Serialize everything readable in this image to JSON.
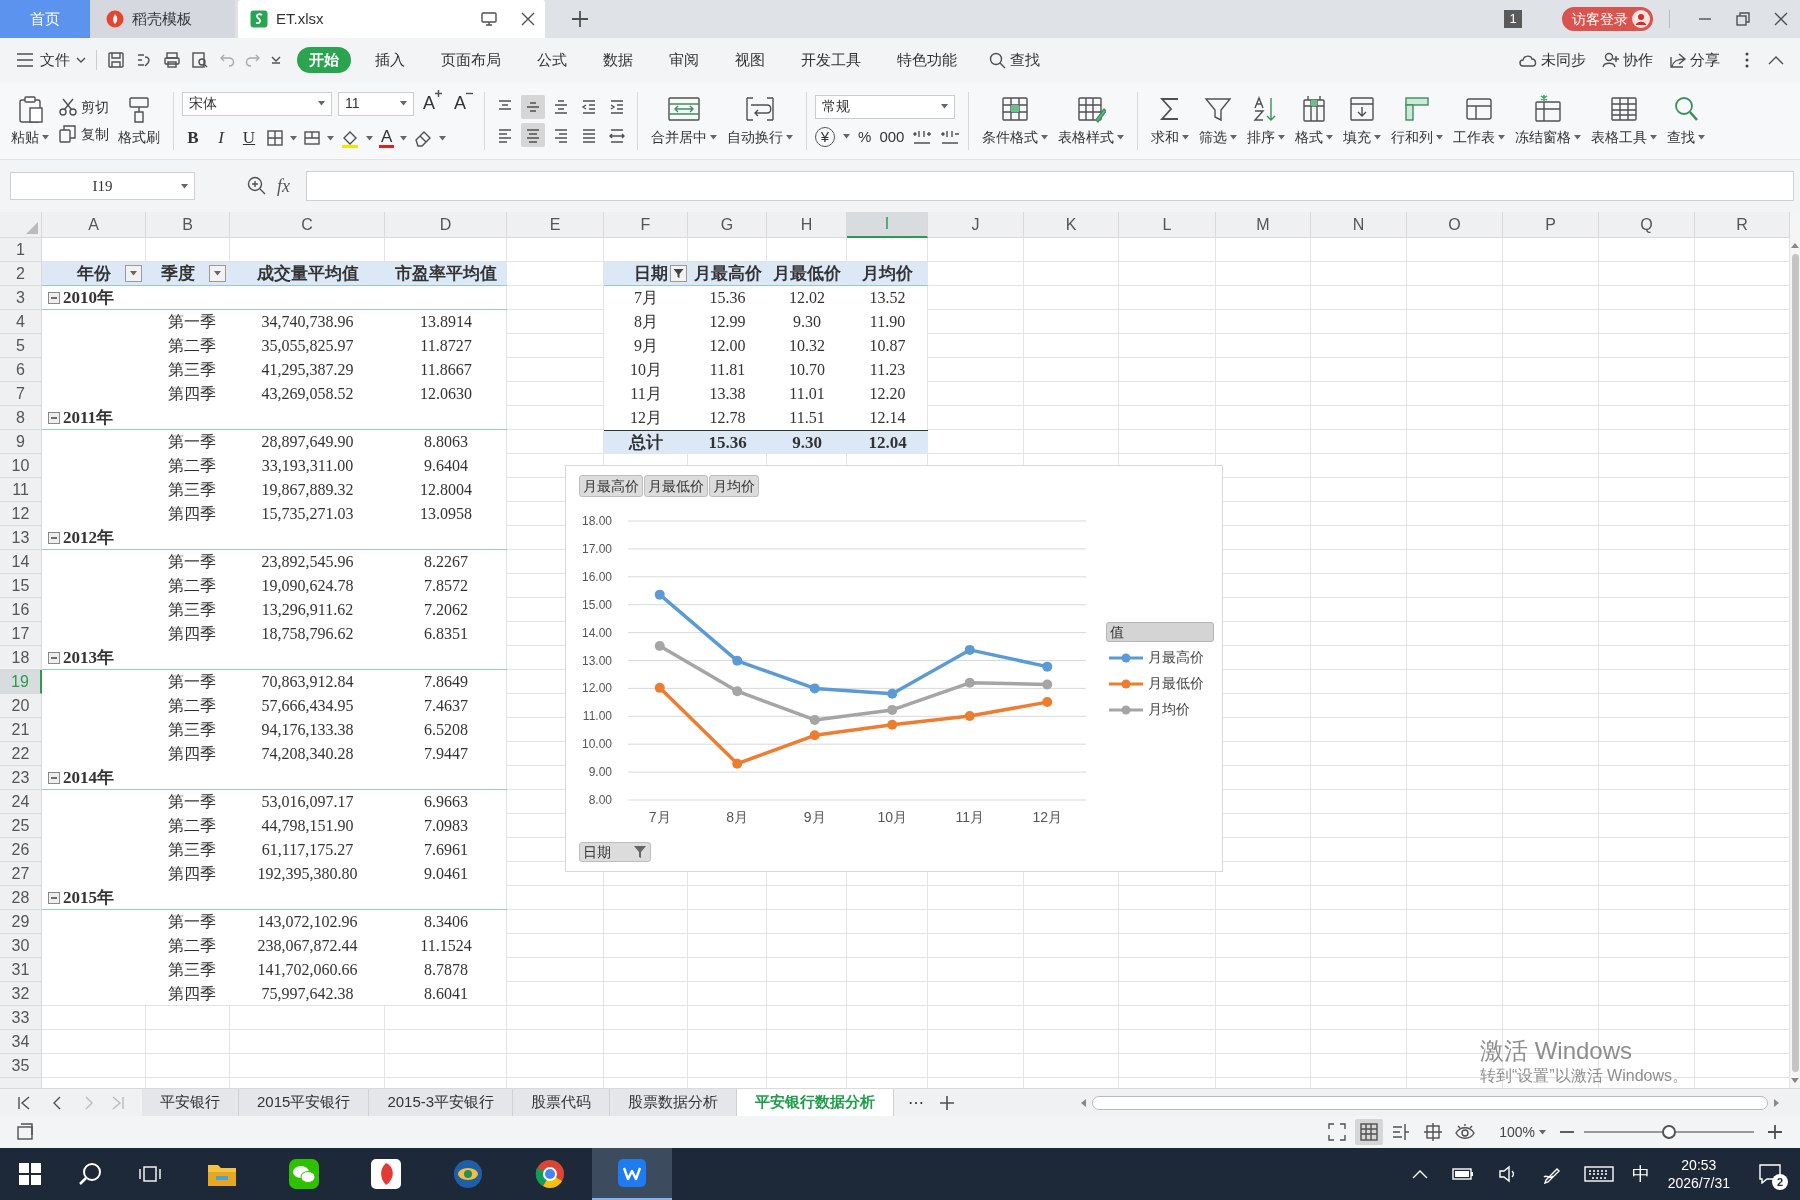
{
  "title_bar": {
    "tabs": [
      {
        "label": "首页",
        "kind": "home",
        "selected": false
      },
      {
        "label": "稻壳模板",
        "kind": "docer",
        "selected": false
      },
      {
        "label": "ET.xlsx",
        "kind": "sheet",
        "selected": true
      }
    ],
    "window_count": "1",
    "login": "访客登录"
  },
  "menu_bar": {
    "file": "文件",
    "tabs": [
      {
        "label": "开始",
        "selected": true
      },
      {
        "label": "插入",
        "selected": false
      },
      {
        "label": "页面布局",
        "selected": false
      },
      {
        "label": "公式",
        "selected": false
      },
      {
        "label": "数据",
        "selected": false
      },
      {
        "label": "审阅",
        "selected": false
      },
      {
        "label": "视图",
        "selected": false
      },
      {
        "label": "开发工具",
        "selected": false
      },
      {
        "label": "特色功能",
        "selected": false
      }
    ],
    "search": "查找",
    "actions": [
      "未同步",
      "协作",
      "分享"
    ]
  },
  "ribbon": {
    "clipboard": [
      {
        "label": "粘贴",
        "kind": "paste"
      },
      {
        "label": "剪切",
        "kind": "cut"
      },
      {
        "label": "复制",
        "kind": "copy"
      },
      {
        "label": "格式刷",
        "kind": "brush"
      }
    ],
    "font": "宋体",
    "font_size": "11",
    "size_buttons": [
      {
        "glyph": "A",
        "kind": "grow"
      },
      {
        "glyph": "A",
        "kind": "shrink"
      }
    ],
    "style_buttons": [
      "B",
      "I",
      "U"
    ],
    "font_color": "A",
    "alignment": [
      {
        "kind": "top",
        "selected": false
      },
      {
        "kind": "middle",
        "selected": true
      },
      {
        "kind": "bottom",
        "selected": false
      },
      {
        "kind": "outdent",
        "selected": false
      },
      {
        "kind": "indent",
        "selected": false
      },
      {
        "kind": "left",
        "selected": false
      },
      {
        "kind": "center",
        "selected": true
      },
      {
        "kind": "right",
        "selected": false
      },
      {
        "kind": "justify",
        "selected": false
      },
      {
        "kind": "distributed",
        "selected": false
      }
    ],
    "merge_buttons": [
      {
        "label": "合并居中",
        "kind": "merge"
      },
      {
        "label": "自动换行",
        "kind": "wrap"
      }
    ],
    "number_format": "常规",
    "number_buttons": [
      "¥",
      "%",
      "000"
    ],
    "tools": [
      {
        "label": "条件格式",
        "kind": "conditional"
      },
      {
        "label": "表格样式",
        "kind": "style"
      },
      {
        "label": "求和",
        "kind": "sum"
      },
      {
        "label": "筛选",
        "kind": "filter"
      },
      {
        "label": "排序",
        "kind": "sort"
      },
      {
        "label": "格式",
        "kind": "format"
      },
      {
        "label": "填充",
        "kind": "fill"
      },
      {
        "label": "行和列",
        "kind": "rows"
      },
      {
        "label": "工作表",
        "kind": "sheet"
      },
      {
        "label": "冻结窗格",
        "kind": "freeze"
      },
      {
        "label": "表格工具",
        "kind": "table"
      },
      {
        "label": "查找",
        "kind": "find"
      }
    ]
  },
  "formula_bar": {
    "cell": "I19",
    "fx": "fx"
  },
  "sheet": {
    "columns": [
      {
        "label": "A",
        "selected": false
      },
      {
        "label": "B",
        "selected": false
      },
      {
        "label": "C",
        "selected": false
      },
      {
        "label": "D",
        "selected": false
      },
      {
        "label": "E",
        "selected": false
      },
      {
        "label": "F",
        "selected": false
      },
      {
        "label": "G",
        "selected": false
      },
      {
        "label": "H",
        "selected": false
      },
      {
        "label": "I",
        "selected": true
      },
      {
        "label": "J",
        "selected": false
      },
      {
        "label": "K",
        "selected": false
      },
      {
        "label": "L",
        "selected": false
      },
      {
        "label": "M",
        "selected": false
      },
      {
        "label": "N",
        "selected": false
      },
      {
        "label": "O",
        "selected": false
      },
      {
        "label": "P",
        "selected": false
      },
      {
        "label": "Q",
        "selected": false
      },
      {
        "label": "R",
        "selected": false
      }
    ],
    "rows": [
      {
        "label": "1",
        "selected": false
      },
      {
        "label": "2",
        "selected": false
      },
      {
        "label": "3",
        "selected": false
      },
      {
        "label": "4",
        "selected": false
      },
      {
        "label": "5",
        "selected": false
      },
      {
        "label": "6",
        "selected": false
      },
      {
        "label": "7",
        "selected": false
      },
      {
        "label": "8",
        "selected": false
      },
      {
        "label": "9",
        "selected": false
      },
      {
        "label": "10",
        "selected": false
      },
      {
        "label": "11",
        "selected": false
      },
      {
        "label": "12",
        "selected": false
      },
      {
        "label": "13",
        "selected": false
      },
      {
        "label": "14",
        "selected": false
      },
      {
        "label": "15",
        "selected": false
      },
      {
        "label": "16",
        "selected": false
      },
      {
        "label": "17",
        "selected": false
      },
      {
        "label": "18",
        "selected": false
      },
      {
        "label": "19",
        "selected": true
      },
      {
        "label": "20",
        "selected": false
      },
      {
        "label": "21",
        "selected": false
      },
      {
        "label": "22",
        "selected": false
      },
      {
        "label": "23",
        "selected": false
      },
      {
        "label": "24",
        "selected": false
      },
      {
        "label": "25",
        "selected": false
      },
      {
        "label": "26",
        "selected": false
      },
      {
        "label": "27",
        "selected": false
      },
      {
        "label": "28",
        "selected": false
      },
      {
        "label": "29",
        "selected": false
      },
      {
        "label": "30",
        "selected": false
      },
      {
        "label": "31",
        "selected": false
      },
      {
        "label": "32",
        "selected": false
      },
      {
        "label": "33",
        "selected": false
      },
      {
        "label": "34",
        "selected": false
      },
      {
        "label": "35",
        "selected": false
      }
    ],
    "pivot_1": {
      "headers": [
        {
          "label": "年份",
          "filter": true,
          "filtered": false
        },
        {
          "label": "季度",
          "filter": true,
          "filtered": false
        },
        {
          "label": "成交量平均值"
        },
        {
          "label": "市盈率平均值"
        }
      ],
      "groups": [
        {
          "year": "2010年",
          "expanded": true,
          "quarters": [
            {
              "quarter": "第一季",
              "volume": "34,740,738.96",
              "pe": "13.8914"
            },
            {
              "quarter": "第二季",
              "volume": "35,055,825.97",
              "pe": "11.8727"
            },
            {
              "quarter": "第三季",
              "volume": "41,295,387.29",
              "pe": "11.8667"
            },
            {
              "quarter": "第四季",
              "volume": "43,269,058.52",
              "pe": "12.0630"
            }
          ]
        },
        {
          "year": "2011年",
          "expanded": true,
          "quarters": [
            {
              "quarter": "第一季",
              "volume": "28,897,649.90",
              "pe": "8.8063"
            },
            {
              "quarter": "第二季",
              "volume": "33,193,311.00",
              "pe": "9.6404"
            },
            {
              "quarter": "第三季",
              "volume": "19,867,889.32",
              "pe": "12.8004"
            },
            {
              "quarter": "第四季",
              "volume": "15,735,271.03",
              "pe": "13.0958"
            }
          ]
        },
        {
          "year": "2012年",
          "expanded": true,
          "quarters": [
            {
              "quarter": "第一季",
              "volume": "23,892,545.96",
              "pe": "8.2267"
            },
            {
              "quarter": "第二季",
              "volume": "19,090,624.78",
              "pe": "7.8572"
            },
            {
              "quarter": "第三季",
              "volume": "13,296,911.62",
              "pe": "7.2062"
            },
            {
              "quarter": "第四季",
              "volume": "18,758,796.62",
              "pe": "6.8351"
            }
          ]
        },
        {
          "year": "2013年",
          "expanded": true,
          "quarters": [
            {
              "quarter": "第一季",
              "volume": "70,863,912.84",
              "pe": "7.8649"
            },
            {
              "quarter": "第二季",
              "volume": "57,666,434.95",
              "pe": "7.4637"
            },
            {
              "quarter": "第三季",
              "volume": "94,176,133.38",
              "pe": "6.5208"
            },
            {
              "quarter": "第四季",
              "volume": "74,208,340.28",
              "pe": "7.9447"
            }
          ]
        },
        {
          "year": "2014年",
          "expanded": true,
          "quarters": [
            {
              "quarter": "第一季",
              "volume": "53,016,097.17",
              "pe": "6.9663"
            },
            {
              "quarter": "第二季",
              "volume": "44,798,151.90",
              "pe": "7.0983"
            },
            {
              "quarter": "第三季",
              "volume": "61,117,175.27",
              "pe": "7.6961"
            },
            {
              "quarter": "第四季",
              "volume": "192,395,380.80",
              "pe": "9.0461"
            }
          ]
        },
        {
          "year": "2015年",
          "expanded": true,
          "quarters": [
            {
              "quarter": "第一季",
              "volume": "143,072,102.96",
              "pe": "8.3406"
            },
            {
              "quarter": "第二季",
              "volume": "238,067,872.44",
              "pe": "11.1524"
            },
            {
              "quarter": "第三季",
              "volume": "141,702,060.66",
              "pe": "8.7878"
            },
            {
              "quarter": "第四季",
              "volume": "75,997,642.38",
              "pe": "8.6041"
            }
          ]
        }
      ]
    },
    "pivot_2": {
      "headers": [
        {
          "label": "日期",
          "filter": true,
          "filtered": true
        },
        {
          "label": "月最高价"
        },
        {
          "label": "月最低价"
        },
        {
          "label": "月均价"
        }
      ],
      "rows": [
        {
          "month": "7月",
          "high": "15.36",
          "low": "12.02",
          "avg": "13.52"
        },
        {
          "month": "8月",
          "high": "12.99",
          "low": "9.30",
          "avg": "11.90"
        },
        {
          "month": "9月",
          "high": "12.00",
          "low": "10.32",
          "avg": "10.87"
        },
        {
          "month": "10月",
          "high": "11.81",
          "low": "10.70",
          "avg": "11.23"
        },
        {
          "month": "11月",
          "high": "13.38",
          "low": "11.01",
          "avg": "12.20"
        },
        {
          "month": "12月",
          "high": "12.78",
          "low": "11.51",
          "avg": "12.14"
        }
      ],
      "total": {
        "label": "总计",
        "high": "15.36",
        "low": "9.30",
        "avg": "12.04"
      }
    },
    "chart": {
      "field_buttons": [
        "月最高价",
        "月最低价",
        "月均价"
      ],
      "legend_title": "值",
      "axis_field": "日期",
      "chart_data": {
        "type": "line",
        "categories": [
          "7月",
          "8月",
          "9月",
          "10月",
          "11月",
          "12月"
        ],
        "series": [
          {
            "name": "月最高价",
            "color": "#5b9bd5",
            "marker": "circle",
            "values": [
              15.36,
              12.99,
              12.0,
              11.81,
              13.38,
              12.78
            ]
          },
          {
            "name": "月最低价",
            "color": "#ed7d31",
            "marker": "circle",
            "values": [
              12.02,
              9.3,
              10.32,
              10.7,
              11.01,
              11.51
            ]
          },
          {
            "name": "月均价",
            "color": "#a5a5a5",
            "marker": "circle",
            "values": [
              13.52,
              11.9,
              10.87,
              11.23,
              12.2,
              12.14
            ]
          }
        ],
        "ylim": [
          8,
          18
        ],
        "grid": true,
        "legend": true,
        "yticks": [
          {
            "value": 8,
            "label": "8.00"
          },
          {
            "value": 9,
            "label": "9.00"
          },
          {
            "value": 10,
            "label": "10.00"
          },
          {
            "value": 11,
            "label": "11.00"
          },
          {
            "value": 12,
            "label": "12.00"
          },
          {
            "value": 13,
            "label": "13.00"
          },
          {
            "value": 14,
            "label": "14.00"
          },
          {
            "value": 15,
            "label": "15.00"
          },
          {
            "value": 16,
            "label": "16.00"
          },
          {
            "value": 17,
            "label": "17.00"
          },
          {
            "value": 18,
            "label": "18.00"
          }
        ]
      }
    }
  },
  "sheet_tabs": [
    {
      "label": "平安银行",
      "selected": false
    },
    {
      "label": "2015平安银行",
      "selected": false
    },
    {
      "label": "2015-3平安银行",
      "selected": false
    },
    {
      "label": "股票代码",
      "selected": false
    },
    {
      "label": "股票数据分析",
      "selected": false
    },
    {
      "label": "平安银行数据分析",
      "selected": true
    }
  ],
  "sheet_tab_more": "⋯",
  "status_bar": {
    "views": [
      {
        "kind": "fullscreen",
        "selected": false
      },
      {
        "kind": "normal",
        "selected": true
      },
      {
        "kind": "page_break",
        "selected": false
      },
      {
        "kind": "page",
        "selected": false
      },
      {
        "kind": "eye",
        "selected": false
      }
    ],
    "zoom": "100%",
    "zoom_slider": {
      "level": 0.5
    }
  },
  "taskbar": {
    "apps": [
      {
        "kind": "explorer",
        "selected": false
      },
      {
        "kind": "chat",
        "selected": false
      },
      {
        "kind": "red",
        "selected": false
      },
      {
        "kind": "globe",
        "selected": false
      },
      {
        "kind": "browser",
        "selected": false
      },
      {
        "kind": "wps",
        "selected": true
      }
    ],
    "ime": "中",
    "time": "20:53",
    "date": "2026/7/31",
    "notifications": "2"
  },
  "activation_notice": {
    "title": "激活 Windows",
    "text": "转到“设置”以激活 Windows。"
  }
}
